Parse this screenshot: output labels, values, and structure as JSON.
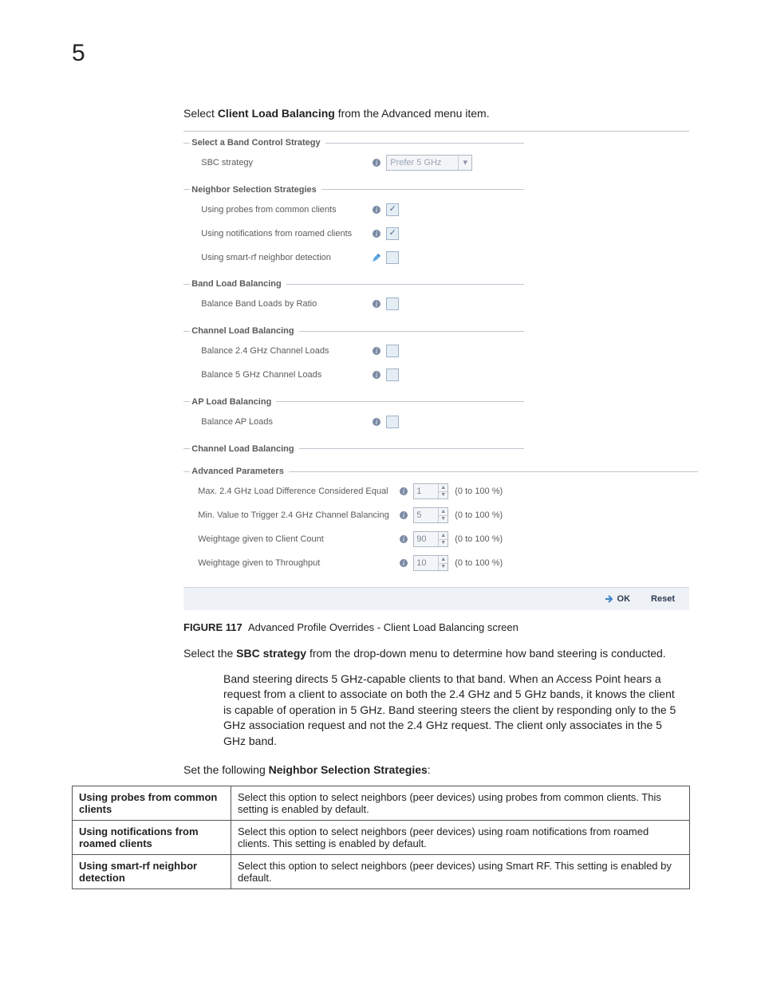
{
  "chapter_number": "5",
  "intro_prefix": "Select ",
  "intro_bold": "Client Load Balancing",
  "intro_suffix": " from the Advanced menu item.",
  "panel": {
    "sections": {
      "band_control": {
        "legend": "Select a Band Control Strategy",
        "sbc_label": "SBC strategy",
        "sbc_value": "Prefer 5 GHz"
      },
      "neighbor": {
        "legend": "Neighbor Selection Strategies",
        "probes": "Using probes from common clients",
        "notifs": "Using notifications from roamed clients",
        "smartrf": "Using smart-rf neighbor detection"
      },
      "band_load": {
        "legend": "Band Load Balancing",
        "ratio": "Balance Band Loads by Ratio"
      },
      "chan_load": {
        "legend": "Channel Load Balancing",
        "c24": "Balance 2.4 GHz Channel Loads",
        "c5": "Balance 5 GHz Channel Loads"
      },
      "ap_load": {
        "legend": "AP Load Balancing",
        "ap": "Balance AP Loads"
      },
      "chan_load2": {
        "legend": "Channel Load Balancing"
      },
      "adv": {
        "legend": "Advanced Parameters",
        "r1_label": "Max. 2.4 GHz Load Difference Considered Equal",
        "r1_value": "1",
        "r2_label": "Min. Value to Trigger 2.4 GHz Channel Balancing",
        "r2_value": "5",
        "r3_label": "Weightage given to Client Count",
        "r3_value": "90",
        "r4_label": "Weightage given to Throughput",
        "r4_value": "10",
        "range": "(0 to 100 %)"
      }
    },
    "buttons": {
      "ok": "OK",
      "reset": "Reset"
    }
  },
  "figure": {
    "label": "FIGURE 117",
    "caption": "Advanced Profile Overrides - Client Load Balancing screen"
  },
  "body": {
    "sbc_prefix": "Select the ",
    "sbc_bold": "SBC strategy",
    "sbc_suffix": " from the drop-down menu to determine how band steering is conducted.",
    "band_steer": "Band steering directs 5 GHz-capable clients to that band. When an Access Point hears a request from a client to associate on both the 2.4 GHz and 5 GHz bands, it knows the client is capable of operation in 5 GHz. Band steering steers the client by responding only to the 5 GHz association request and not the 2.4 GHz request. The client only associates in the 5 GHz band.",
    "nss_prefix": "Set the following ",
    "nss_bold": "Neighbor Selection Strategies",
    "nss_suffix": ":"
  },
  "table": {
    "r1t": "Using probes from common clients",
    "r1d": "Select this option to select neighbors (peer devices) using probes from common clients. This setting is enabled by default.",
    "r2t": "Using notifications from roamed clients",
    "r2d": "Select this option to select neighbors (peer devices) using roam notifications from roamed clients. This setting is enabled by default.",
    "r3t": "Using smart-rf neighbor detection",
    "r3d": "Select this option to select neighbors (peer devices) using Smart RF. This setting is enabled by default."
  }
}
